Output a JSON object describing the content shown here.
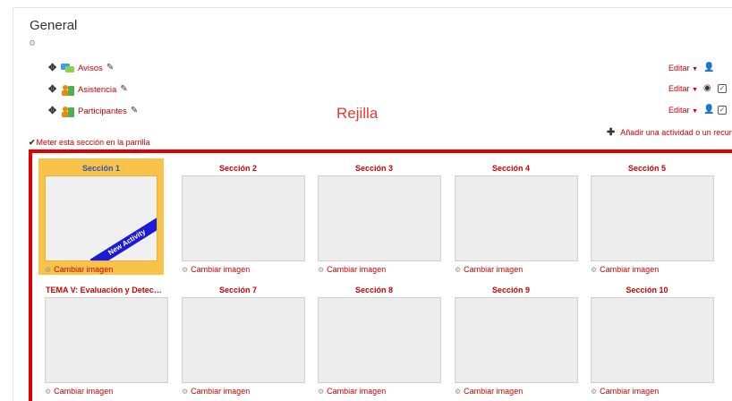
{
  "section": {
    "title": "General"
  },
  "activities": [
    {
      "label": "Avisos",
      "icon": "forum-icon",
      "color": "#3ba0e6"
    },
    {
      "label": "Asistencia",
      "icon": "attendance-icon",
      "color": "#e48b0c"
    },
    {
      "label": "Participantes",
      "icon": "participants-icon",
      "color": "#e48b0c"
    }
  ],
  "edit_label": "Editar",
  "annotation": "Rejilla",
  "add_activity_label": "Añadir una actividad o un recur",
  "meter_label": "Meter esta sección en la parrilla",
  "change_image_label": "Cambiar imagen",
  "new_activity_label": "New Activity",
  "tiles": [
    {
      "title": "Sección 1",
      "current": true,
      "new_activity": true
    },
    {
      "title": "Sección 2"
    },
    {
      "title": "Sección 3"
    },
    {
      "title": "Sección 4"
    },
    {
      "title": "Sección 5"
    },
    {
      "title": "TEMA V: Evaluación y Detecci..."
    },
    {
      "title": "Sección 7"
    },
    {
      "title": "Sección 8"
    },
    {
      "title": "Sección 9"
    },
    {
      "title": "Sección 10"
    }
  ],
  "colors": {
    "link": "#cc0000",
    "current_tile": "#f9c34a",
    "current_title": "#2a52be",
    "frame": "#e00000",
    "ribbon": "#1a1ad8"
  }
}
